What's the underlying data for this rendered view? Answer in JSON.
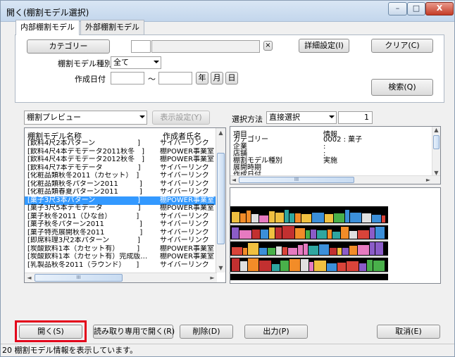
{
  "window": {
    "title": "開く(棚割モデル選択)",
    "min_glyph": "–",
    "max_glyph": "□",
    "close_glyph": "X"
  },
  "tabs": [
    {
      "label": "内部棚割モデル",
      "active": true
    },
    {
      "label": "外部棚割モデル",
      "active": false
    }
  ],
  "search": {
    "category_button": "カテゴリー",
    "category_value": "",
    "clear_glyph": "×",
    "model_type_label": "棚割モデル種別",
    "model_type_value": "全て",
    "created_date_label": "作成日付",
    "date_from": "",
    "date_separator": "～",
    "date_to": "",
    "year_button": "年",
    "month_button": "月",
    "day_button": "日",
    "detail_button": "詳細設定(I)",
    "clear_button": "クリア(C)",
    "search_button": "検索(Q)"
  },
  "preview_bar": {
    "preview_select": "棚割プレビュー",
    "display_settings_button": "表示設定(Y)",
    "selection_method_label": "選択方法",
    "selection_method_value": "直接選択",
    "count_value": "1"
  },
  "model_list": {
    "columns": [
      "棚割モデル名称",
      "作成者氏名"
    ],
    "rows": [
      {
        "name": "[飲料4尺2本パターン　　　　　　]",
        "author": "サイバーリンク"
      },
      {
        "name": "[飲料4尺4本デモデータ2011秋冬　]",
        "author": "棚POWER事業室"
      },
      {
        "name": "[飲料4尺4本デモデータ2012秋冬　]",
        "author": "棚POWER事業室"
      },
      {
        "name": "[飲料4尺7本デモデータ　　　　　]",
        "author": "サイバーリンク"
      },
      {
        "name": "[化粧品類秋冬2011（カセット）　]",
        "author": "サイバーリンク"
      },
      {
        "name": "[化粧品類秋冬パターン2011　　　]",
        "author": "サイバーリンク"
      },
      {
        "name": "[化粧品類春夏パターン2011　　　]",
        "author": "サイバーリンク"
      },
      {
        "name": "[菓子3尺3本パターン　　　　　　]",
        "author": "棚POWER事業室",
        "selected": true
      },
      {
        "name": "[菓子3尺5本デモデータ　　　　　]",
        "author": "棚POWER事業室"
      },
      {
        "name": "[菓子秋冬2011（ひな台）　　　　]",
        "author": "サイバーリンク"
      },
      {
        "name": "[菓子秋冬パターン2011　　　　　]",
        "author": "サイバーリンク"
      },
      {
        "name": "[菓子特売展開秋冬2011　　　　　]",
        "author": "サイバーリンク"
      },
      {
        "name": "[即席料理3尺2本パターン　　　　]",
        "author": "サイバーリンク"
      },
      {
        "name": "[炭酸飲料1本（カセット有）　　　]",
        "author": "棚POWER事業室"
      },
      {
        "name": "[炭酸飲料1本（カセット有）完成版…",
        "author": "棚POWER事業室"
      },
      {
        "name": "[乳製品秋冬2011（ラウンド）　　]",
        "author": "サイバーリンク"
      }
    ]
  },
  "info_table": {
    "columns": [
      "項目",
      "情報"
    ],
    "rows": [
      {
        "item": "カテゴリー",
        "value": "0002 : 菓子"
      },
      {
        "item": "企業",
        "value": ":"
      },
      {
        "item": "店舗",
        "value": ":"
      },
      {
        "item": "棚割モデル種別",
        "value": "実施"
      },
      {
        "item": "展開時期",
        "value": ""
      },
      {
        "item": "作成日付",
        "value": ""
      }
    ]
  },
  "scroll": {
    "up": "▲",
    "down": "▼",
    "left": "◄",
    "right": "►",
    "grip": "III"
  },
  "buttons": {
    "open": "開く(S)",
    "open_readonly": "読み取り専用で開く(R)",
    "delete": "削除(D)",
    "output": "出力(P)",
    "cancel": "取消(E)"
  },
  "status": "20 棚割モデル情報を表示しています。",
  "colors": {
    "selection": "#3399ff",
    "highlight_box": "#e3001b",
    "preview_bg": "#000000"
  }
}
